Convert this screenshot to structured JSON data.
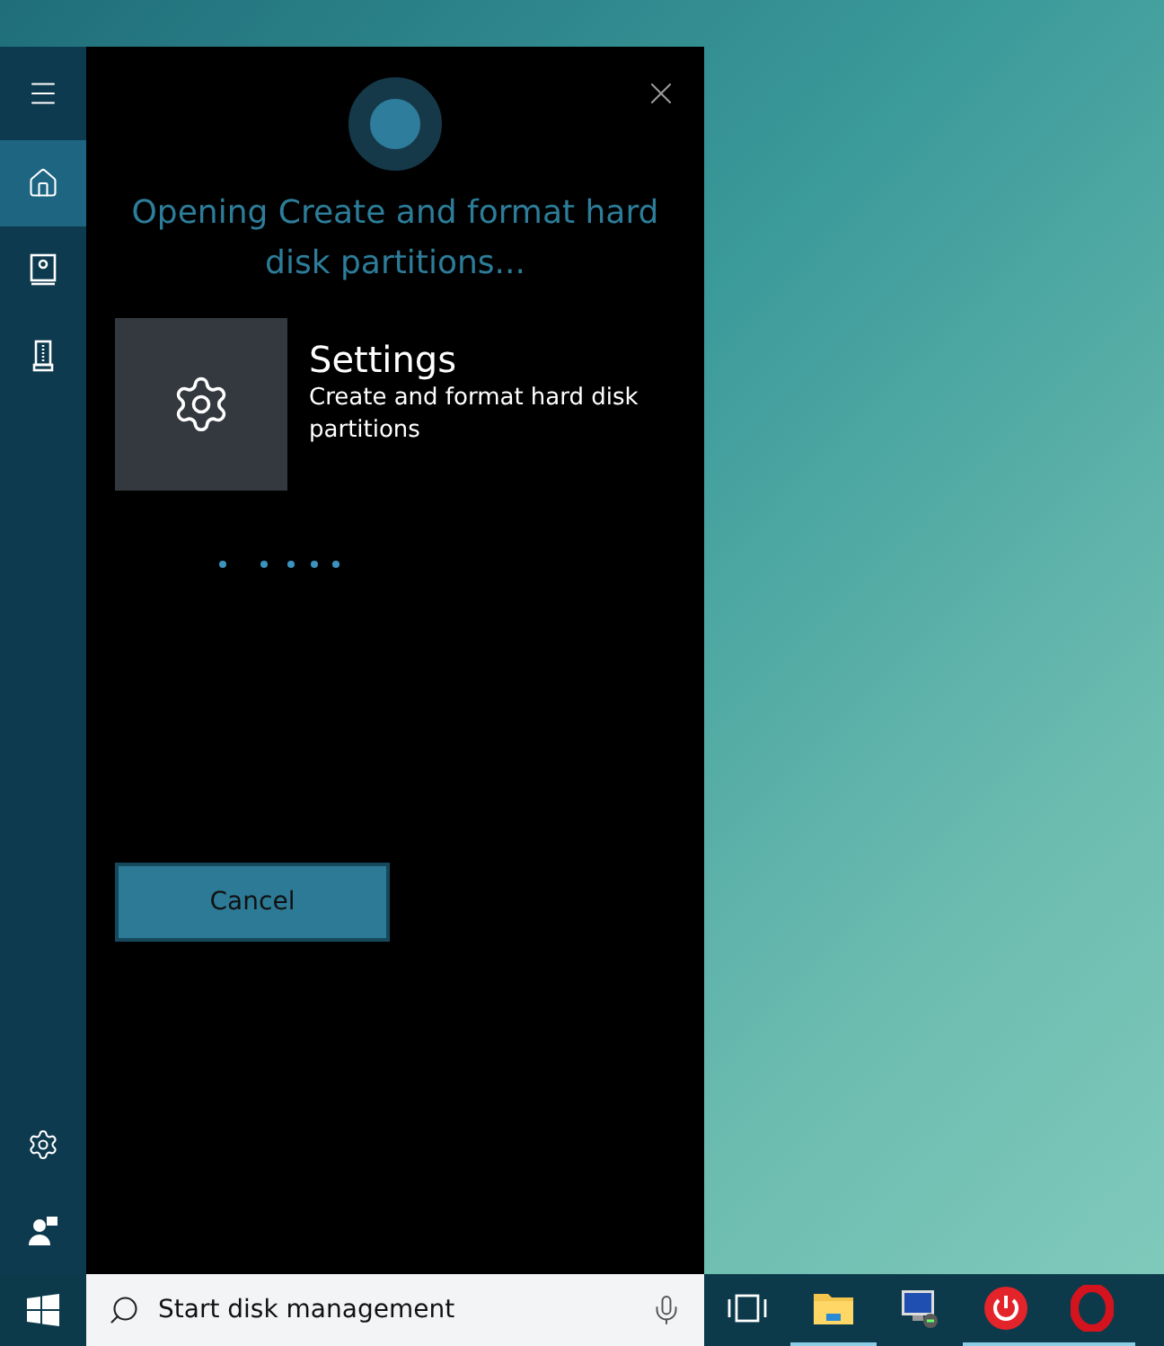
{
  "sidebar": {
    "items": [
      {
        "kind": "menu",
        "selected": false
      },
      {
        "kind": "home",
        "selected": true
      },
      {
        "kind": "notebook",
        "selected": false
      },
      {
        "kind": "devices",
        "selected": false
      }
    ],
    "bottom_items": [
      {
        "kind": "settings"
      },
      {
        "kind": "feedback"
      }
    ]
  },
  "cortana": {
    "heading": "Opening Create and format hard disk partitions...",
    "result": {
      "title": "Settings",
      "description": "Create and format hard disk partitions"
    },
    "cancel_button": "Cancel"
  },
  "taskbar": {
    "search": {
      "value": "Start disk management"
    },
    "apps": [
      {
        "kind": "task-view",
        "running": false
      },
      {
        "kind": "file-explorer",
        "running": true
      },
      {
        "kind": "remote-desktop",
        "running": false
      },
      {
        "kind": "power",
        "running": true
      },
      {
        "kind": "opera",
        "running": true
      }
    ]
  }
}
